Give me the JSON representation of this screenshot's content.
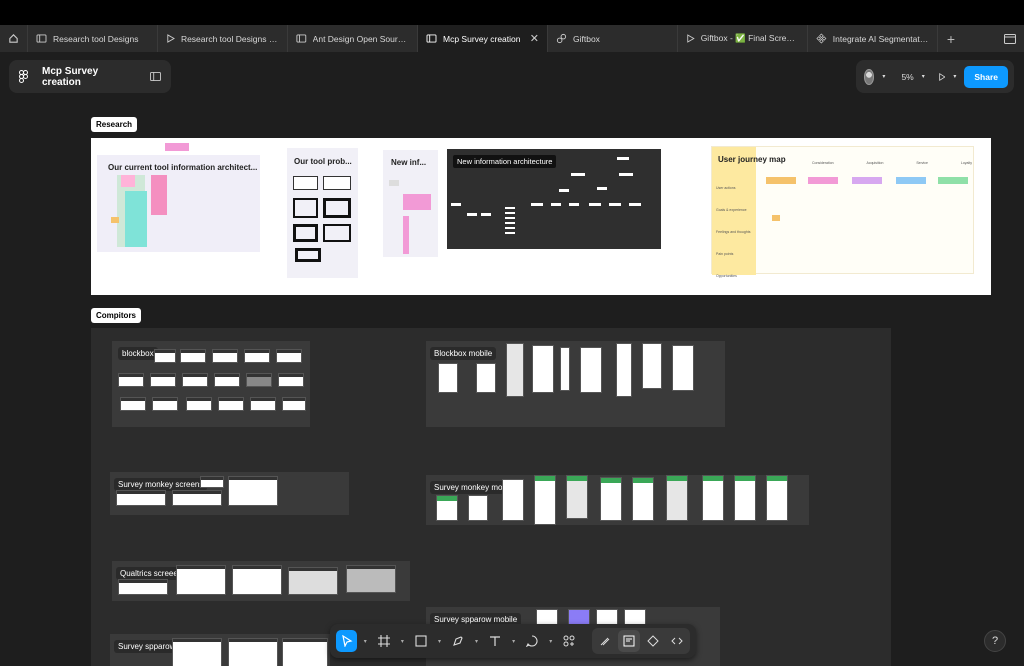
{
  "tabs": [
    {
      "label": "Research tool Designs",
      "icon": "board-icon"
    },
    {
      "label": "Research tool Designs - P",
      "icon": "play-icon"
    },
    {
      "label": "Ant Design Open Source (",
      "icon": "board-icon"
    },
    {
      "label": "Mcp Survey creation",
      "icon": "board-icon",
      "active": true
    },
    {
      "label": "Giftbox",
      "icon": "link-icon"
    },
    {
      "label": "Giftbox - ✅ Final Screen c",
      "icon": "play-icon"
    },
    {
      "label": "Integrate AI Segmentation",
      "icon": "component-icon"
    }
  ],
  "file": {
    "title": "Mcp Survey creation"
  },
  "header": {
    "zoom": "5%",
    "share_label": "Share"
  },
  "sections": {
    "research": "Research",
    "compitors": "Compitors"
  },
  "research_frames": {
    "current_ia": "Our current tool information architect...",
    "tool_prob": "Our tool prob...",
    "new_inf": "New inf...",
    "new_ia": "New information architecture",
    "journey": "User journey map"
  },
  "journey_map": {
    "rows": [
      "User actions",
      "Goals & experience",
      "Feelings and thoughts",
      "Pain points",
      "Opportunities"
    ],
    "columns": [
      "Consideration",
      "Acquisition",
      "Service",
      "Loyalty"
    ],
    "column_colors": [
      "#f5c26b",
      "#f29ad6",
      "#d7a8f0",
      "#8ec9f5",
      "#8fe0a8"
    ]
  },
  "competitor_groups": {
    "blockbox": "blockbox",
    "blockbox_mobile": "Blockbox mobile",
    "survey_monkey": "Survey monkey screens",
    "survey_monkey_mobile": "Survey monkey mobile",
    "qualtrics": "Qualtrics  screeens",
    "spparow": "Survey spparow",
    "spparow_mobile": "Survey spparow mobile"
  },
  "help_label": "?"
}
